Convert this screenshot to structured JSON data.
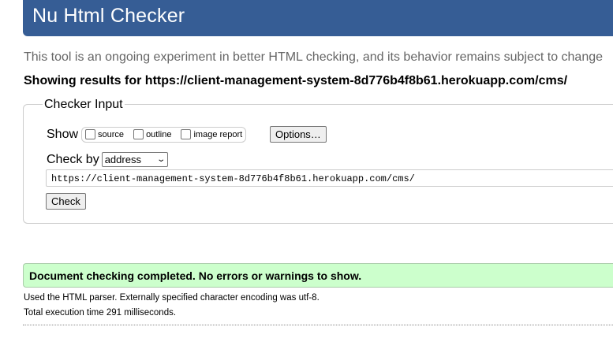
{
  "header": {
    "title": "Nu Html Checker"
  },
  "intro": "This tool is an ongoing experiment in better HTML checking, and its behavior remains subject to change",
  "showing_results": "Showing results for https://client-management-system-8d776b4f8b61.herokuapp.com/cms/",
  "checker": {
    "legend": "Checker Input",
    "show_label": "Show",
    "options": [
      {
        "label": "source",
        "checked": false
      },
      {
        "label": "outline",
        "checked": false
      },
      {
        "label": "image report",
        "checked": false
      }
    ],
    "options_button": "Options…",
    "checkby_label": "Check by",
    "checkby_selected": "address",
    "url_value": "https://client-management-system-8d776b4f8b61.herokuapp.com/cms/",
    "check_button": "Check"
  },
  "result": {
    "success": "Document checking completed. No errors or warnings to show.",
    "parser_note": "Used the HTML parser. Externally specified character encoding was utf-8.",
    "execution_time": "Total execution time 291 milliseconds."
  },
  "colors": {
    "header_bg": "#365d95",
    "success_bg": "#ccffcc"
  }
}
